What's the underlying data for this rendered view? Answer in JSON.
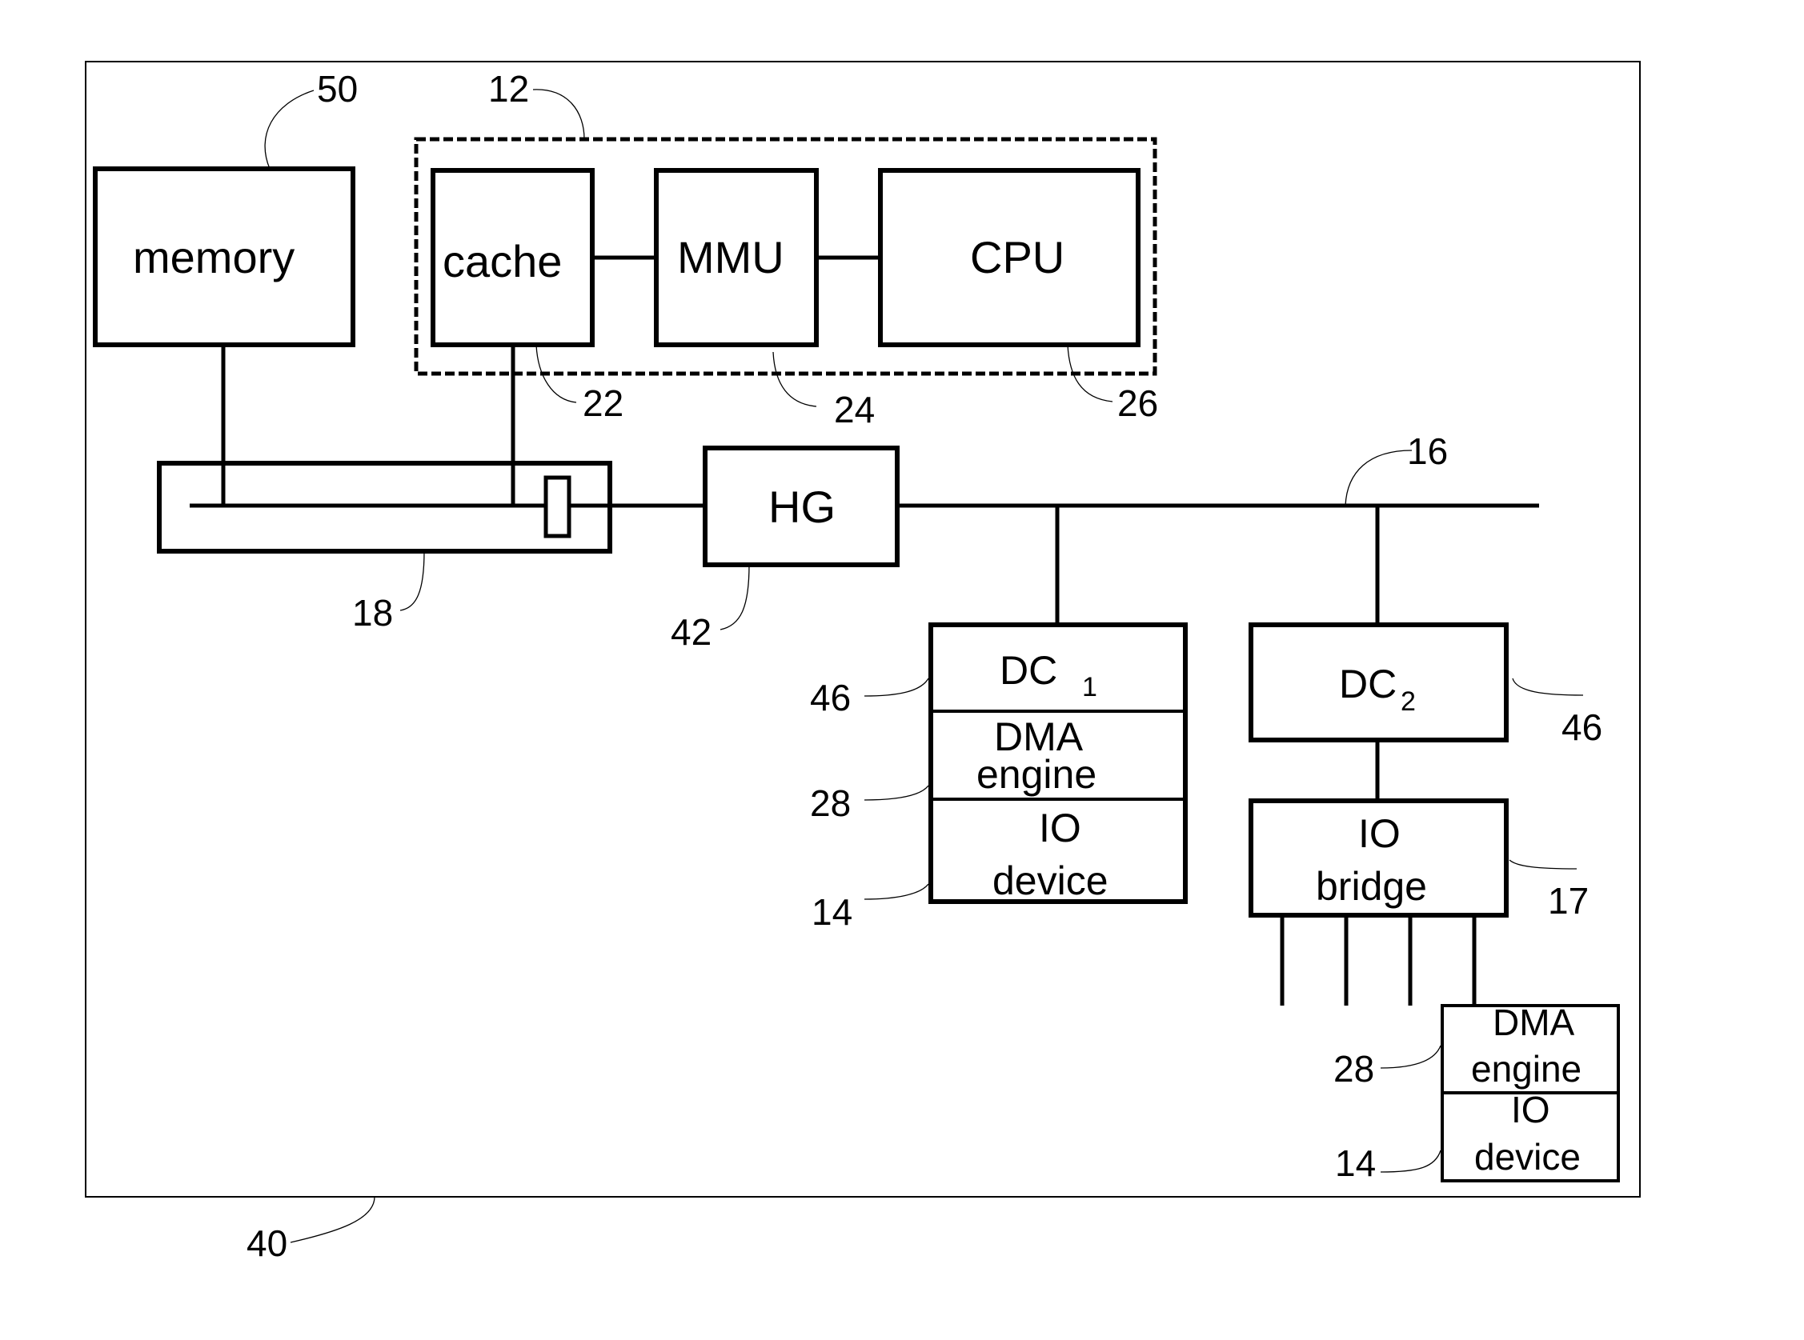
{
  "diagram": {
    "system_ref": "40",
    "blocks": {
      "memory": {
        "label": "memory",
        "ref": "50"
      },
      "processor_group": {
        "ref": "12"
      },
      "cache": {
        "label": "cache",
        "ref": "22"
      },
      "mmu": {
        "label": "MMU",
        "ref": "24"
      },
      "cpu": {
        "label": "CPU",
        "ref": "26"
      },
      "interconnect": {
        "ref": "18"
      },
      "hg": {
        "label": "HG",
        "ref": "42"
      },
      "bus": {
        "ref": "16"
      },
      "dc1": {
        "label_main": "DC",
        "label_sub": "1",
        "ref": "46",
        "dma_line1": "DMA",
        "dma_line2": "engine",
        "dma_ref": "28",
        "io_line1": "IO",
        "io_line2": "device",
        "io_ref": "14"
      },
      "dc2": {
        "label_main": "DC",
        "label_sub": "2",
        "ref": "46"
      },
      "io_bridge": {
        "line1": "IO",
        "line2": "bridge",
        "ref": "17"
      },
      "bridge_device": {
        "dma_line1": "DMA",
        "dma_line2": "engine",
        "dma_ref": "28",
        "io_line1": "IO",
        "io_line2": "device",
        "io_ref": "14"
      }
    }
  }
}
